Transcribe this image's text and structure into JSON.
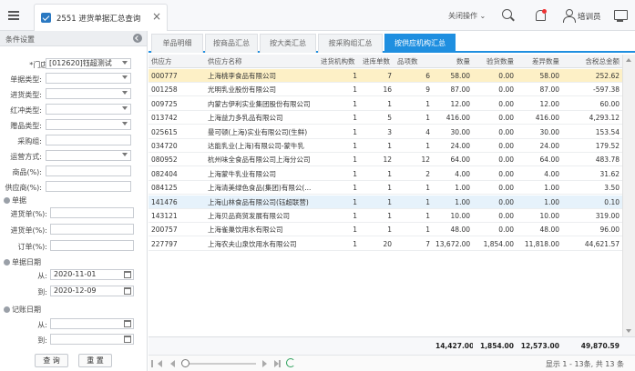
{
  "topbar": {
    "tab_title": "2551 进货单据汇总查询",
    "tab_close": "×",
    "close_ops": "关闭操作 ⌄",
    "user_name": "培训员"
  },
  "filter": {
    "title": "条件设置",
    "store_label": "*门店:",
    "store_value": "[012620]钰超测试",
    "doc_type_label": "单据类型:",
    "stock_type_label": "进货类型:",
    "red_type_label": "红冲类型:",
    "gift_type_label": "赠品类型:",
    "buyer_group_label": "采购组:",
    "delivery_label": "运营方式:",
    "product_label": "商品(%):",
    "supplier_label": "供应商(%):",
    "doc_group": "单据",
    "stock_in_label": "进货单(%):",
    "stock_out_label": "进货单(%):",
    "order_label": "订单(%):",
    "doc_date_group": "单据日期",
    "from_label": "从:",
    "from_value": "2020-11-01",
    "to_label": "到:",
    "to_value": "2020-12-09",
    "post_date_group": "记账日期",
    "post_from_label": "从:",
    "post_to_label": "到:",
    "query_button": "查 询",
    "reset_button": "重 置"
  },
  "subtabs": [
    "单品明细",
    "按商品汇总",
    "按大类汇总",
    "按采购组汇总",
    "按供应机构汇总"
  ],
  "columns": [
    "供应方",
    "供应方名称",
    "进货机构数",
    "进库单数",
    "品项数",
    "数量",
    "验货数量",
    "差异数量",
    "含税总金额"
  ],
  "rows": [
    {
      "code": "000777",
      "name": "上海桃李食品有限公司",
      "orgs": "1",
      "docs": "7",
      "items": "6",
      "qty": "58.00",
      "checked": "0.00",
      "diff": "58.00",
      "amount": "252.62"
    },
    {
      "code": "001258",
      "name": "光明乳业股份有限公司",
      "orgs": "1",
      "docs": "16",
      "items": "9",
      "qty": "87.00",
      "checked": "0.00",
      "diff": "87.00",
      "amount": "-597.38"
    },
    {
      "code": "009725",
      "name": "内蒙古伊利实业集团股份有限公司",
      "orgs": "1",
      "docs": "1",
      "items": "1",
      "qty": "12.00",
      "checked": "0.00",
      "diff": "12.00",
      "amount": "60.00"
    },
    {
      "code": "013742",
      "name": "上海益力多乳品有限公司",
      "orgs": "1",
      "docs": "5",
      "items": "1",
      "qty": "416.00",
      "checked": "0.00",
      "diff": "416.00",
      "amount": "4,293.12"
    },
    {
      "code": "025615",
      "name": "曼可顿(上海)实业有限公司(生鲜)",
      "orgs": "1",
      "docs": "3",
      "items": "4",
      "qty": "30.00",
      "checked": "0.00",
      "diff": "30.00",
      "amount": "153.54"
    },
    {
      "code": "034720",
      "name": "达能乳业(上海)有限公司-蒙牛乳",
      "orgs": "1",
      "docs": "1",
      "items": "1",
      "qty": "24.00",
      "checked": "0.00",
      "diff": "24.00",
      "amount": "179.52"
    },
    {
      "code": "080952",
      "name": "杭州味全食品有限公司上海分公司",
      "orgs": "1",
      "docs": "12",
      "items": "12",
      "qty": "64.00",
      "checked": "0.00",
      "diff": "64.00",
      "amount": "483.78"
    },
    {
      "code": "082404",
      "name": "上海蒙牛乳业有限公司",
      "orgs": "1",
      "docs": "1",
      "items": "2",
      "qty": "4.00",
      "checked": "0.00",
      "diff": "4.00",
      "amount": "31.62"
    },
    {
      "code": "084125",
      "name": "上海清美绿色食品(集团)有限公(...",
      "orgs": "1",
      "docs": "1",
      "items": "1",
      "qty": "1.00",
      "checked": "0.00",
      "diff": "1.00",
      "amount": "3.50"
    },
    {
      "code": "141476",
      "name": "上海山林食品有限公司(钰超联营)",
      "orgs": "1",
      "docs": "1",
      "items": "1",
      "qty": "1.00",
      "checked": "0.00",
      "diff": "1.00",
      "amount": "0.10"
    },
    {
      "code": "143121",
      "name": "上海贝品商贸发展有限公司",
      "orgs": "1",
      "docs": "1",
      "items": "1",
      "qty": "10.00",
      "checked": "0.00",
      "diff": "10.00",
      "amount": "319.00"
    },
    {
      "code": "200757",
      "name": "上海雀巢饮用水有限公司",
      "orgs": "1",
      "docs": "1",
      "items": "1",
      "qty": "48.00",
      "checked": "0.00",
      "diff": "48.00",
      "amount": "96.00"
    },
    {
      "code": "227797",
      "name": "上海农夫山泉饮用水有限公司",
      "orgs": "1",
      "docs": "20",
      "items": "7",
      "qty": "13,672.00",
      "checked": "1,854.00",
      "diff": "11,818.00",
      "amount": "44,621.57"
    }
  ],
  "totals": {
    "qty": "14,427.00",
    "checked": "1,854.00",
    "diff": "12,573.00",
    "amount": "49,870.59"
  },
  "pager": {
    "info": "显示 1 - 13条, 共 13 条"
  },
  "colors": {
    "accent": "#1f8fe0",
    "selected_row": "#fdf0c6",
    "hover_row": "#e6f2fb",
    "required": "#e33333"
  }
}
